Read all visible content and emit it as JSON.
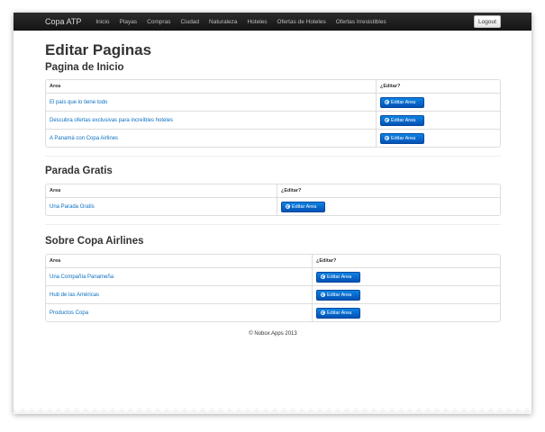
{
  "navbar": {
    "brand": "Copa ATP",
    "items": [
      "Inicio",
      "Playas",
      "Compras",
      "Ciudad",
      "Naturaleza",
      "Hoteles",
      "Ofertas de Hoteles",
      "Ofertas Irresistibles"
    ],
    "logout_label": "Logout"
  },
  "page": {
    "title": "Editar Paginas"
  },
  "sections": [
    {
      "title": "Pagina de Inicio",
      "col_area": "Area",
      "col_edit": "¿Editar?",
      "rows": [
        "El país que lo tiene todo",
        "Descubra ofertas exclusivas para increíbles hoteles",
        "A Panamá con Copa Airlines"
      ]
    },
    {
      "title": "Parada Gratis",
      "col_area": "Area",
      "col_edit": "¿Editar?",
      "rows": [
        "Una Parada Gratis"
      ]
    },
    {
      "title": "Sobre Copa Airlines",
      "col_area": "Area",
      "col_edit": "¿Editar?",
      "rows": [
        "Una Compañía Panameña",
        "Hub de las Américas",
        "Productos Copa"
      ]
    }
  ],
  "edit_button_label": "Editar Area",
  "footer": "© Nobox Apps 2013",
  "colors": {
    "navbar": "#1b1b1b",
    "link": "#0a6fc2",
    "button": "#0668cc"
  }
}
